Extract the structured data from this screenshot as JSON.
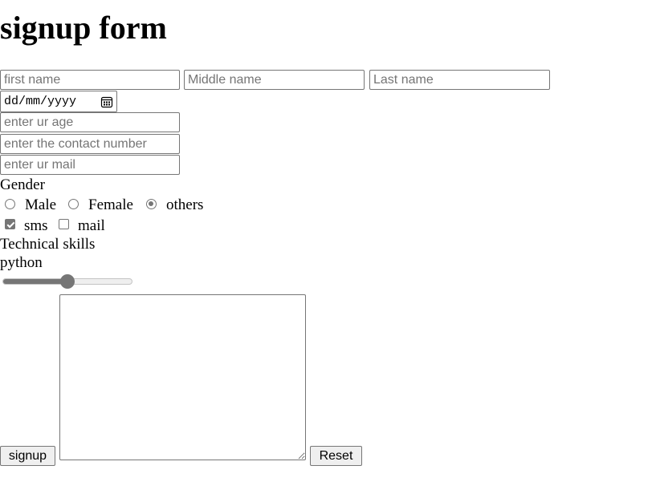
{
  "form": {
    "title": "signup form",
    "first_name_placeholder": "first name",
    "middle_name_placeholder": "Middle name",
    "last_name_placeholder": "Last name",
    "dob_placeholder": "dd/mm/yyyy",
    "age_placeholder": "enter ur age",
    "contact_placeholder": "enter the contact number",
    "mail_placeholder": "enter ur mail",
    "gender_label": "Gender",
    "gender_options": [
      {
        "label": "Male",
        "selected": false
      },
      {
        "label": "Female",
        "selected": false
      },
      {
        "label": "others",
        "selected": true
      }
    ],
    "contact_prefs": [
      {
        "label": "sms",
        "checked": true
      },
      {
        "label": "mail",
        "checked": false
      }
    ],
    "skills_label": "Technical skills",
    "skill_name": "python",
    "skill_level": 0.5,
    "comments_value": "",
    "signup_label": "signup",
    "reset_label": "Reset"
  },
  "icons": {
    "calendar": "calendar-icon"
  },
  "colors": {
    "control_accent": "#767676",
    "control_border": "#767676",
    "button_bg": "#efefef"
  }
}
